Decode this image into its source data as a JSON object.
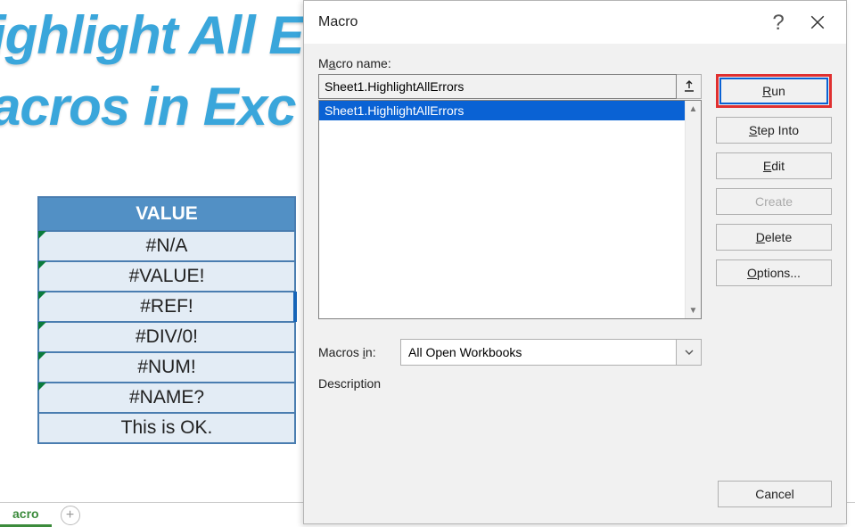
{
  "background": {
    "line1": "ighlight All E",
    "line2": "acros in Exc"
  },
  "table": {
    "header": "VALUE",
    "rows": [
      "#N/A",
      "#VALUE!",
      "#REF!",
      "#DIV/0!",
      "#NUM!",
      "#NAME?",
      "This is OK."
    ]
  },
  "sheet_tabs": {
    "active": "acro"
  },
  "dialog": {
    "title": "Macro",
    "name_label_pre": "M",
    "name_label_ul": "a",
    "name_label_post": "cro name:",
    "name_value": "Sheet1.HighlightAllErrors",
    "list": [
      "Sheet1.HighlightAllErrors"
    ],
    "macros_in_label": "Macros in:",
    "macros_in_ul": "i",
    "macros_in_value": "All Open Workbooks",
    "description_label": "Description",
    "buttons": {
      "run_pre": "",
      "run_ul": "R",
      "run_post": "un",
      "step_pre": "",
      "step_ul": "S",
      "step_post": "tep Into",
      "edit_pre": "",
      "edit_ul": "E",
      "edit_post": "dit",
      "create": "Create",
      "delete_pre": "",
      "delete_ul": "D",
      "delete_post": "elete",
      "options_pre": "",
      "options_ul": "O",
      "options_post": "ptions...",
      "cancel": "Cancel"
    }
  }
}
